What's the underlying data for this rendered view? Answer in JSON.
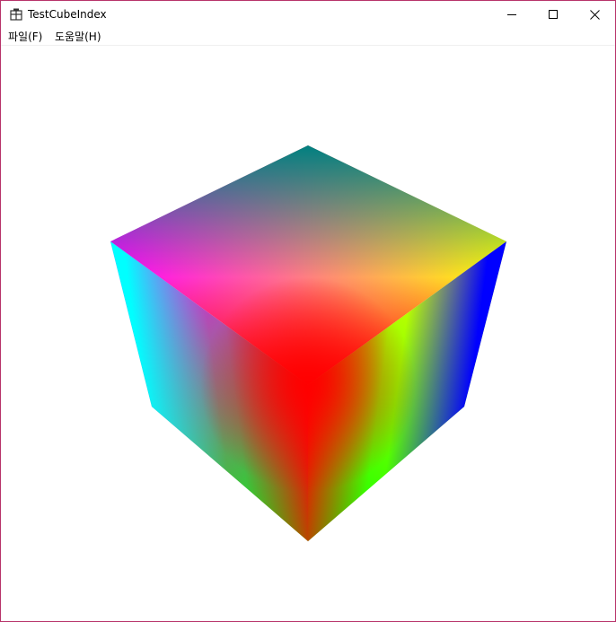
{
  "window": {
    "title": "TestCubeIndex",
    "icon": "app-window-icon",
    "border_color": "#b8336a"
  },
  "caption_buttons": {
    "minimize": "minimize-icon",
    "maximize": "maximize-icon",
    "close": "close-icon"
  },
  "menu": {
    "items": [
      {
        "label": "파일(F)"
      },
      {
        "label": "도움말(H)"
      }
    ]
  },
  "scene": {
    "object": "rgb-color-cube",
    "vertex_colors": {
      "top": "#008080",
      "upper_left": "#ff00ff",
      "upper_right": "#ffff00",
      "center": "#ff0000",
      "lower_left": "#00ffff",
      "lower_right": "#0000ff",
      "bottom": "#00ff00"
    },
    "background": "#ffffff"
  }
}
